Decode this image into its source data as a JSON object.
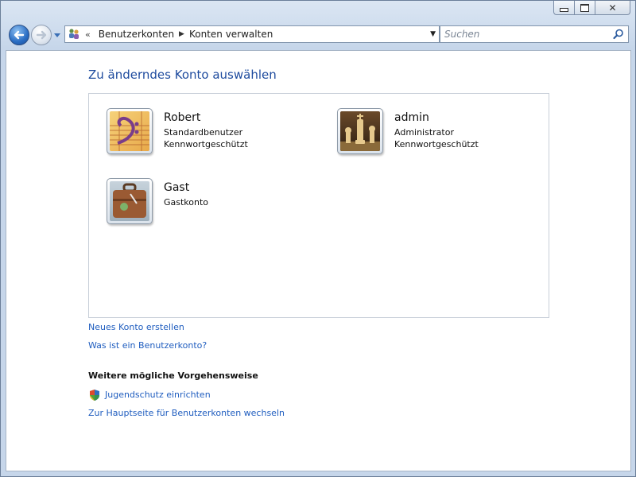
{
  "window": {
    "buttons": {
      "minimize": "minimize-icon",
      "maximize": "maximize-icon",
      "close": "close-icon"
    }
  },
  "nav": {
    "breadcrumb_prefix": "«",
    "breadcrumbs": [
      "Benutzerkonten",
      "Konten verwalten"
    ],
    "search_placeholder": "Suchen"
  },
  "main": {
    "heading": "Zu änderndes Konto auswählen",
    "accounts": [
      {
        "name": "Robert",
        "lines": [
          "Standardbenutzer",
          "Kennwortgeschützt"
        ],
        "icon": "music-clef-avatar"
      },
      {
        "name": "admin",
        "lines": [
          "Administrator",
          "Kennwortgeschützt"
        ],
        "icon": "chess-avatar"
      },
      {
        "name": "Gast",
        "lines": [
          "Gastkonto"
        ],
        "icon": "suitcase-avatar"
      }
    ],
    "links": {
      "create_account": "Neues Konto erstellen",
      "what_is_account": "Was ist ein Benutzerkonto?"
    },
    "more_actions": {
      "title": "Weitere mögliche Vorgehensweise",
      "parental_controls": "Jugendschutz einrichten",
      "main_page": "Zur Hauptseite für Benutzerkonten wechseln"
    }
  },
  "colors": {
    "link": "#1f5dbf",
    "heading": "#1e4b9e"
  }
}
